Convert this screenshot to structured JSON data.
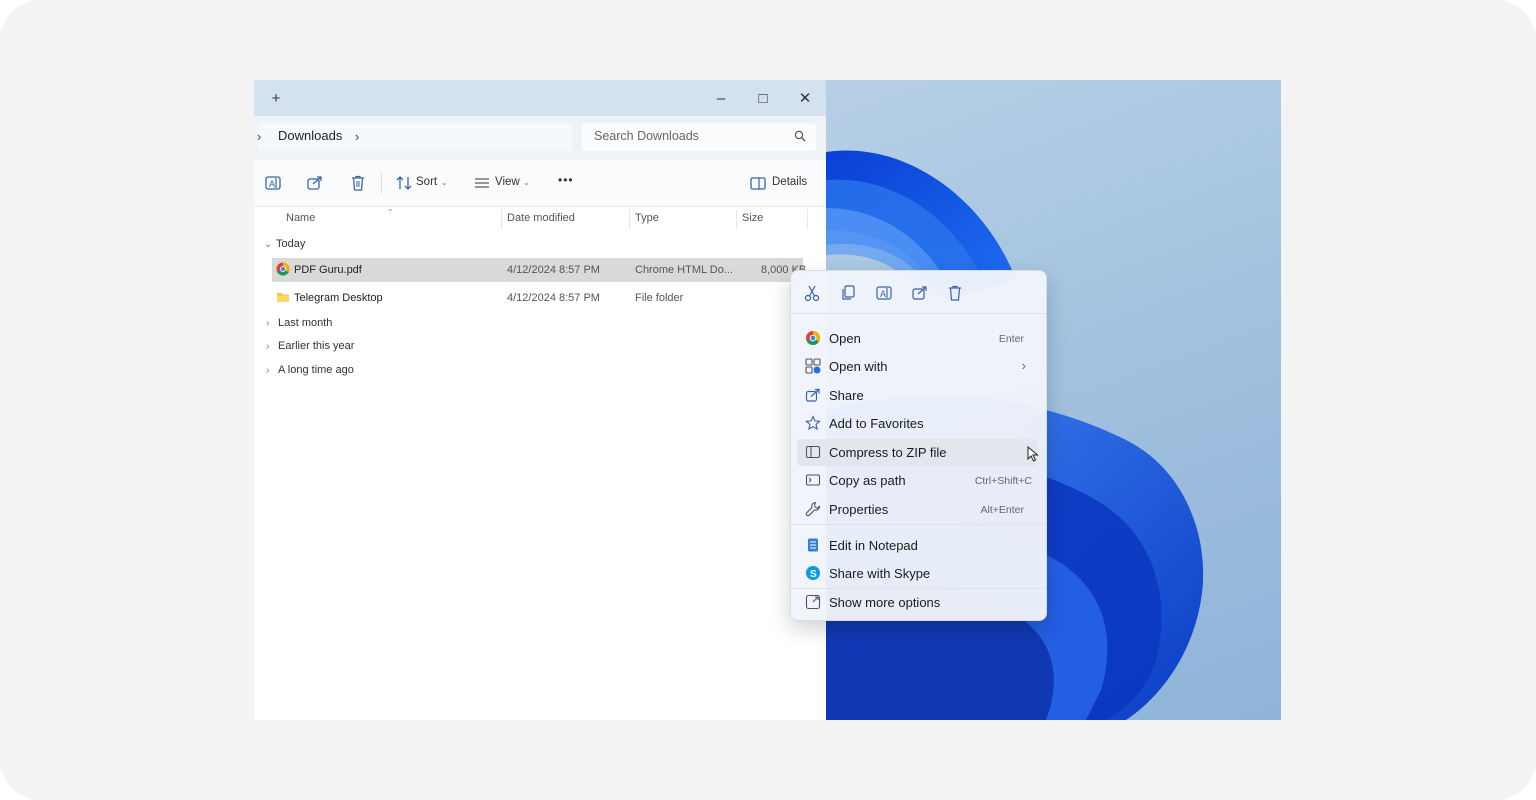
{
  "window": {
    "new_tab_glyph": "+",
    "minimize_glyph": "–",
    "maximize_glyph": "□",
    "close_glyph": "✕"
  },
  "address": {
    "crumb_chevron": "›",
    "location": "Downloads",
    "crumb_chevron_after": "›",
    "search_placeholder": "Search Downloads"
  },
  "toolbar": {
    "sort_label": "Sort",
    "view_label": "View",
    "more_glyph": "•••",
    "details_label": "Details",
    "icons": [
      "rename-icon",
      "share-icon",
      "delete-icon",
      "sort-icon",
      "view-icon",
      "more-icon",
      "details-pane-icon"
    ]
  },
  "columns": {
    "name": "Name",
    "date": "Date modified",
    "type": "Type",
    "size": "Size"
  },
  "groups": {
    "today": "Today",
    "last_month": "Last month",
    "earlier": "Earlier this year",
    "long_ago": "A long time ago"
  },
  "files": [
    {
      "name": "PDF Guru.pdf",
      "date": "4/12/2024 8:57 PM",
      "type": "Chrome HTML Do...",
      "size": "8,000 KB",
      "icon": "chrome-icon",
      "selected": true
    },
    {
      "name": "Telegram Desktop",
      "date": "4/12/2024 8:57 PM",
      "type": "File folder",
      "size": "",
      "icon": "folder-icon",
      "selected": false
    }
  ],
  "context_menu": {
    "top_actions": [
      "cut-icon",
      "copy-icon",
      "rename-icon",
      "share-icon",
      "delete-icon"
    ],
    "items": [
      {
        "label": "Open",
        "shortcut": "Enter",
        "icon": "chrome-icon"
      },
      {
        "label": "Open with",
        "shortcut": "",
        "submenu": "›",
        "icon": "open-with-icon"
      },
      {
        "label": "Share",
        "shortcut": "",
        "icon": "share-icon"
      },
      {
        "label": "Add to Favorites",
        "shortcut": "",
        "icon": "star-icon"
      },
      {
        "label": "Compress to ZIP file",
        "shortcut": "",
        "icon": "zip-icon",
        "hover": true
      },
      {
        "label": "Copy as path",
        "shortcut": "Ctrl+Shift+C",
        "icon": "copy-path-icon"
      },
      {
        "label": "Properties",
        "shortcut": "Alt+Enter",
        "icon": "wrench-icon"
      },
      {
        "label": "Edit in Notepad",
        "shortcut": "",
        "icon": "notepad-icon"
      },
      {
        "label": "Share with Skype",
        "shortcut": "",
        "icon": "skype-icon"
      },
      {
        "label": "Show more options",
        "shortcut": "",
        "icon": "more-options-icon"
      }
    ]
  },
  "colors": {
    "titlebar": "#d4e2ef",
    "selection": "#d9d9d9",
    "accent": "#1a56db",
    "menu_bg": "#f0f4fa"
  }
}
